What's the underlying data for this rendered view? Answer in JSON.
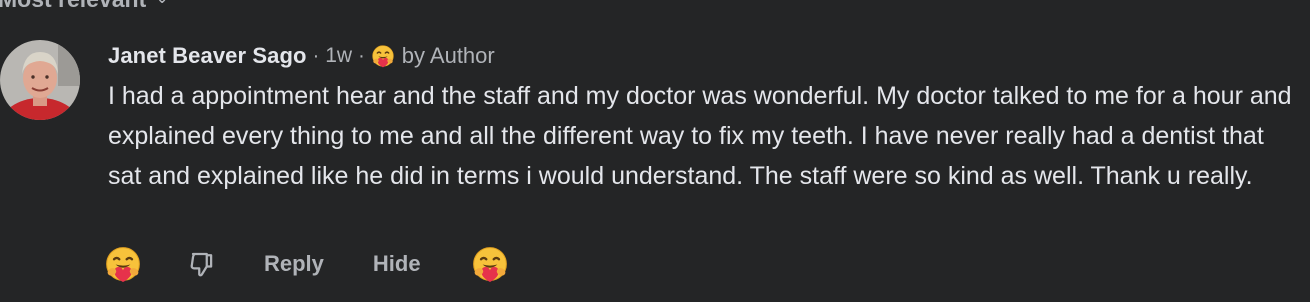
{
  "sort": {
    "label": "Most relevant",
    "icon": "chevron-down-icon"
  },
  "comment": {
    "author": "Janet Beaver Sago",
    "separator": "·",
    "time": "1w",
    "badge_icon": "hugging-face-emoji",
    "badge_label": "by Author",
    "text": "I had a appointment hear and the staff and my doctor was wonderful. My doctor talked to me for a hour and explained every thing to me and all the different way to fix my teeth. I have never really had a dentist that sat and explained like he did in terms i would understand. The staff were so kind as well. Thank u really."
  },
  "actions": {
    "react_icon": "hugging-face-emoji",
    "dislike_icon": "thumbs-down-icon",
    "reply_label": "Reply",
    "hide_label": "Hide",
    "author_reaction_icon": "hugging-face-emoji"
  },
  "colors": {
    "background": "#242526",
    "text_primary": "#e4e6eb",
    "text_secondary": "#b0b3b8"
  }
}
